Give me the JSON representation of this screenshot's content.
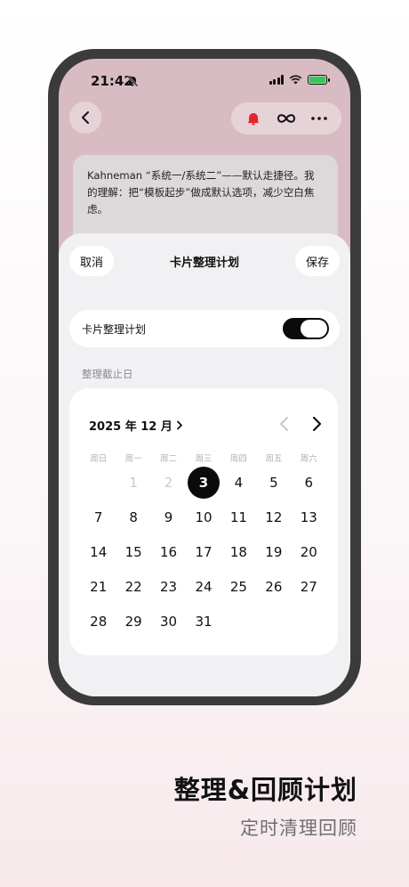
{
  "status_bar": {
    "time": "21:42"
  },
  "note": {
    "text": "Kahneman “系统一/系统二”——默认走捷径。我的理解：把“模板起步”做成默认选项，减少空白焦虑。"
  },
  "sheet": {
    "cancel_label": "取消",
    "title": "卡片整理计划",
    "save_label": "保存",
    "toggle_label": "卡片整理计划",
    "toggle_on": true,
    "section_label": "整理截止日"
  },
  "calendar": {
    "month_label": "2025 年 12 月",
    "weekdays": [
      "周日",
      "周一",
      "周二",
      "周三",
      "周四",
      "周五",
      "周六"
    ],
    "days": [
      {
        "label": "",
        "state": "empty"
      },
      {
        "label": "1",
        "state": "muted"
      },
      {
        "label": "2",
        "state": "muted"
      },
      {
        "label": "3",
        "state": "selected"
      },
      {
        "label": "4",
        "state": "normal"
      },
      {
        "label": "5",
        "state": "normal"
      },
      {
        "label": "6",
        "state": "normal"
      },
      {
        "label": "7",
        "state": "normal"
      },
      {
        "label": "8",
        "state": "normal"
      },
      {
        "label": "9",
        "state": "normal"
      },
      {
        "label": "10",
        "state": "normal"
      },
      {
        "label": "11",
        "state": "normal"
      },
      {
        "label": "12",
        "state": "normal"
      },
      {
        "label": "13",
        "state": "normal"
      },
      {
        "label": "14",
        "state": "normal"
      },
      {
        "label": "15",
        "state": "normal"
      },
      {
        "label": "16",
        "state": "normal"
      },
      {
        "label": "17",
        "state": "normal"
      },
      {
        "label": "18",
        "state": "normal"
      },
      {
        "label": "19",
        "state": "normal"
      },
      {
        "label": "20",
        "state": "normal"
      },
      {
        "label": "21",
        "state": "normal"
      },
      {
        "label": "22",
        "state": "normal"
      },
      {
        "label": "23",
        "state": "normal"
      },
      {
        "label": "24",
        "state": "normal"
      },
      {
        "label": "25",
        "state": "normal"
      },
      {
        "label": "26",
        "state": "normal"
      },
      {
        "label": "27",
        "state": "normal"
      },
      {
        "label": "28",
        "state": "normal"
      },
      {
        "label": "29",
        "state": "normal"
      },
      {
        "label": "30",
        "state": "normal"
      },
      {
        "label": "31",
        "state": "normal"
      }
    ]
  },
  "promo": {
    "title": "整理&回顾计划",
    "subtitle": "定时清理回顾"
  },
  "colors": {
    "accent_red": "#e5242b",
    "battery_green": "#34c759",
    "screen_bg": "#d9bcc3"
  },
  "icons": [
    "bell-slash-icon",
    "signal-icon",
    "wifi-icon",
    "battery-icon",
    "chevron-left-icon",
    "bell-icon",
    "infinity-icon",
    "more-icon",
    "chevron-right-icon"
  ]
}
